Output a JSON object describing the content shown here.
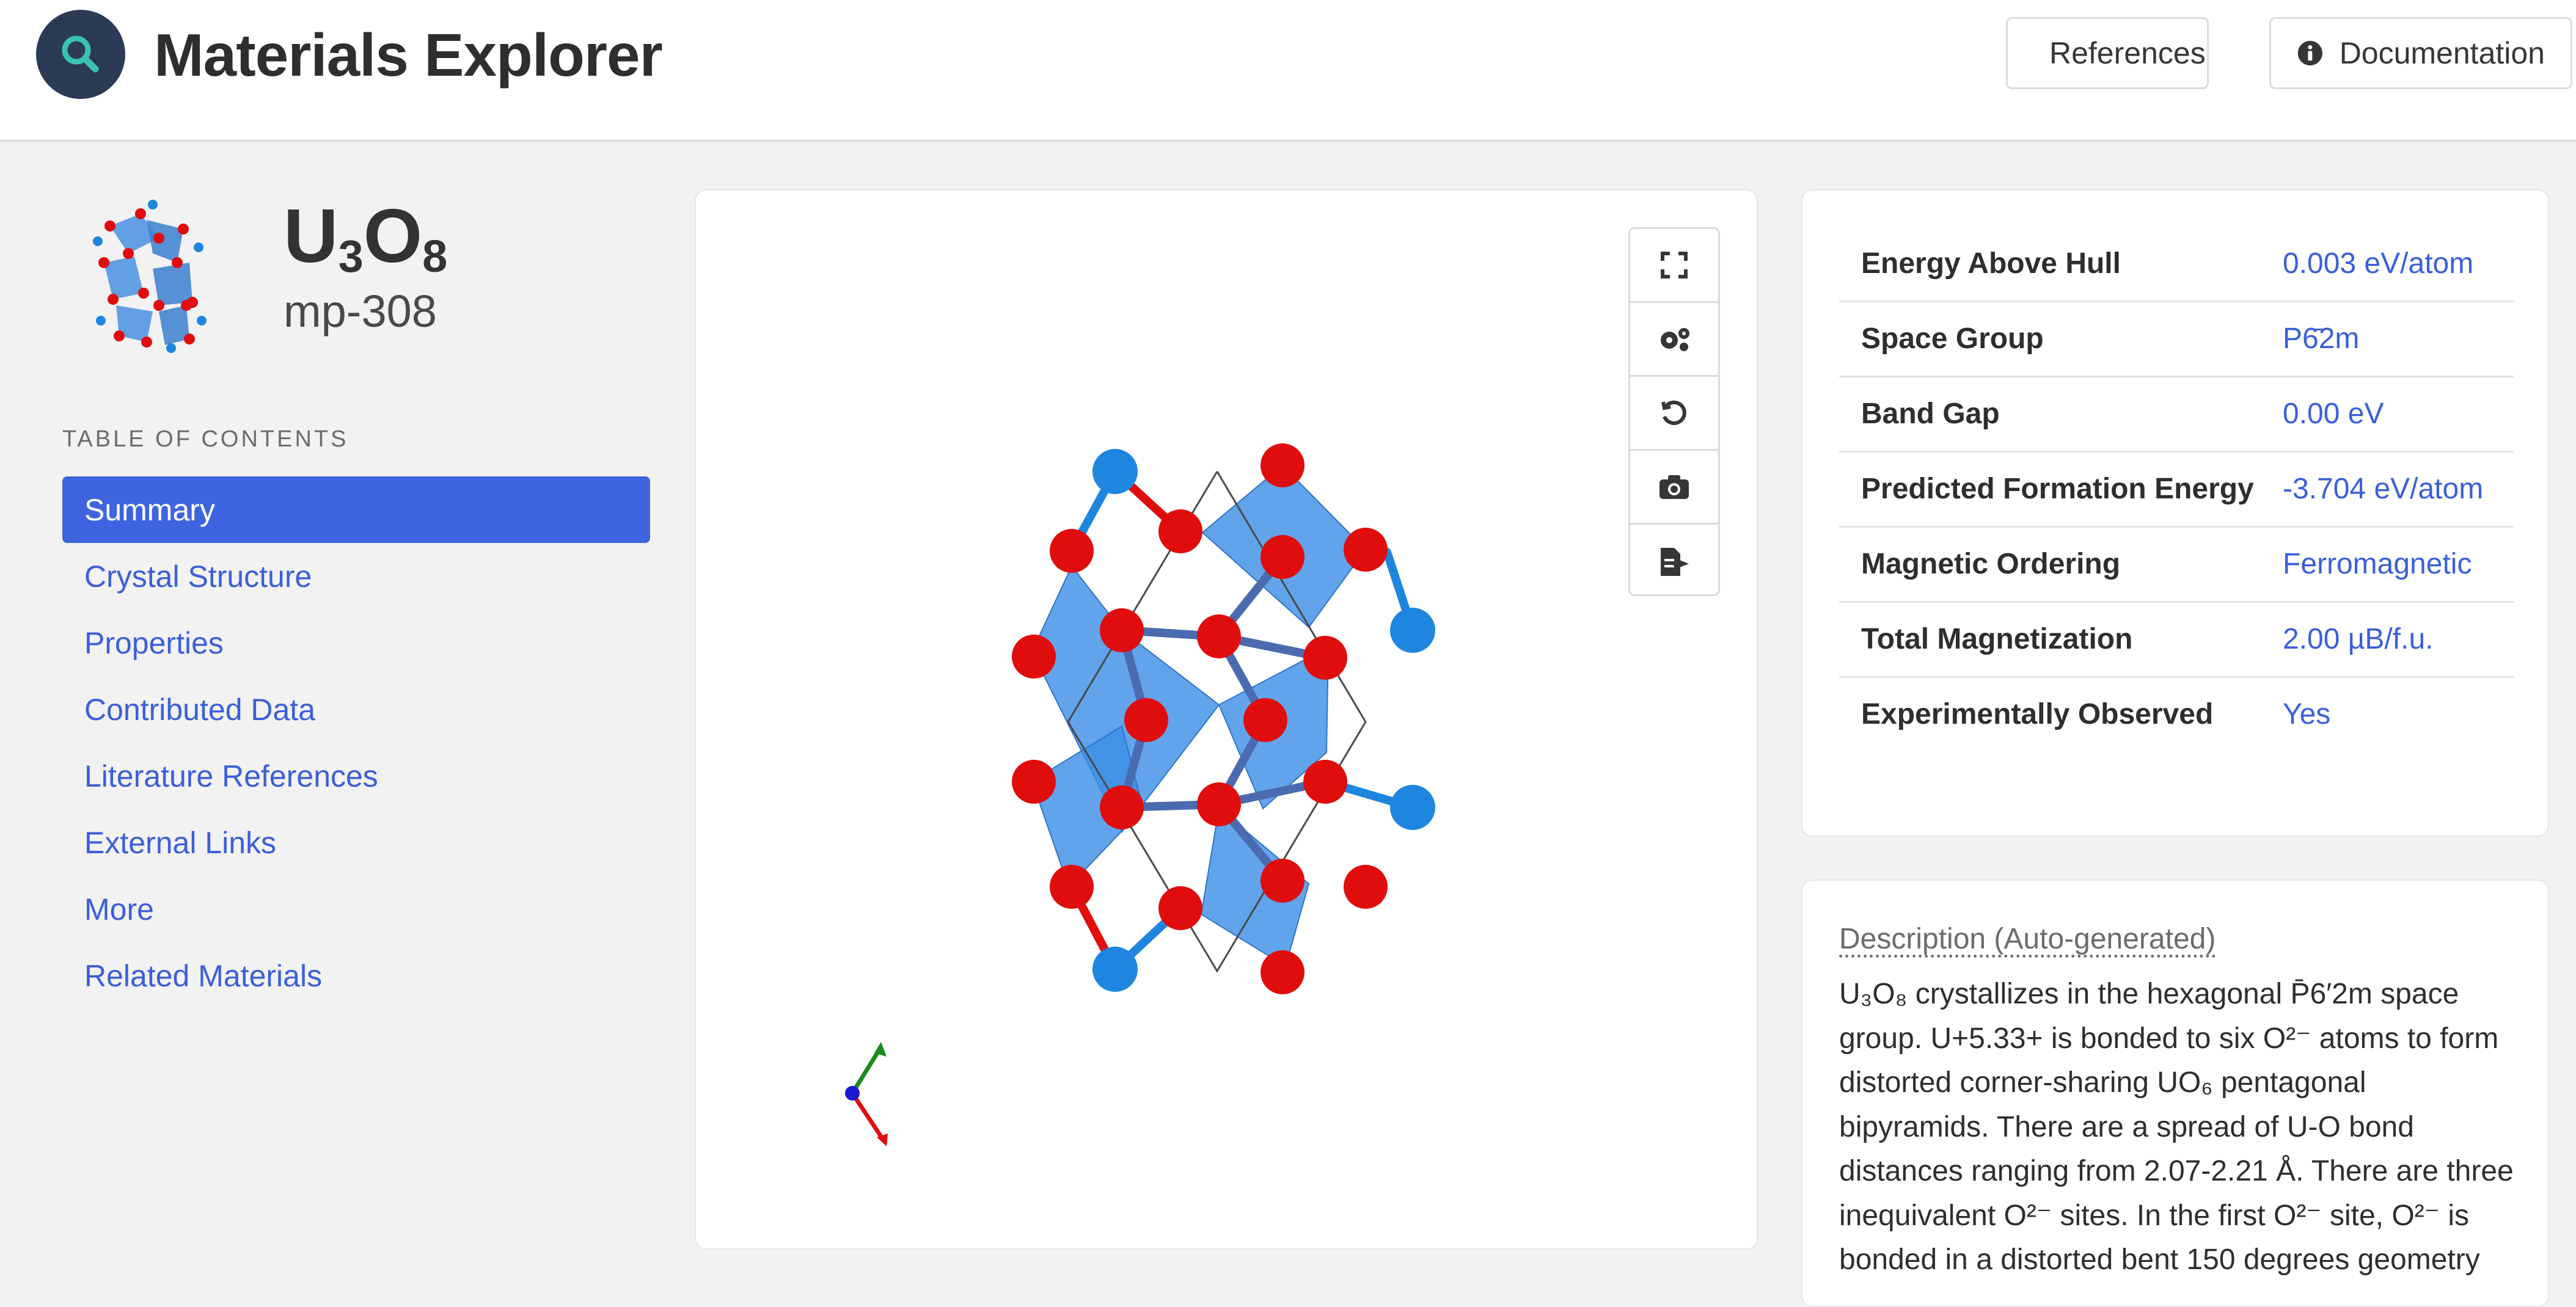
{
  "header": {
    "app_title": "Materials Explorer",
    "logo_icon": "search-icon",
    "buttons": [
      {
        "label": "References",
        "icon": "book-icon"
      },
      {
        "label": "Documentation",
        "icon": "info-icon"
      }
    ]
  },
  "material": {
    "formula_element": "U",
    "formula_u_count": "3",
    "formula_o": "O",
    "formula_o_count": "8",
    "id": "mp-308"
  },
  "toc": {
    "heading": "TABLE OF CONTENTS",
    "items": [
      {
        "label": "Summary",
        "active": true
      },
      {
        "label": "Crystal Structure",
        "active": false
      },
      {
        "label": "Properties",
        "active": false
      },
      {
        "label": "Contributed Data",
        "active": false
      },
      {
        "label": "Literature References",
        "active": false
      },
      {
        "label": "External Links",
        "active": false
      },
      {
        "label": "More",
        "active": false
      },
      {
        "label": "Related Materials",
        "active": false
      }
    ]
  },
  "viewer": {
    "tools": [
      {
        "icon": "expand-icon"
      },
      {
        "icon": "settings-icon"
      },
      {
        "icon": "reset-icon"
      },
      {
        "icon": "camera-icon"
      },
      {
        "icon": "export-icon"
      }
    ],
    "colors": {
      "uranium": "#1f86e0",
      "oxygen": "#e00d0d",
      "polyhedra": "#3b8de6"
    }
  },
  "properties": [
    {
      "key": "Energy Above Hull",
      "value": "0.003 eV/atom"
    },
    {
      "key": "Space Group",
      "value": "P6̄2m"
    },
    {
      "key": "Band Gap",
      "value": "0.00 eV"
    },
    {
      "key": "Predicted Formation Energy",
      "value": "-3.704 eV/atom"
    },
    {
      "key": "Magnetic Ordering",
      "value": "Ferromagnetic"
    },
    {
      "key": "Total Magnetization",
      "value": "2.00 µB/f.u."
    },
    {
      "key": "Experimentally Observed",
      "value": "Yes"
    }
  ],
  "description": {
    "title": "Description (Auto-generated)",
    "text": "U₃O₈ crystallizes in the hexagonal P̄6′2m space group. U+5.33+ is bonded to six O²⁻ atoms to form distorted corner-sharing UO₆ pentagonal bipyramids. There are a spread of U-O bond distances ranging from 2.07-2.21 Å. There are three inequivalent O²⁻ sites. In the first O²⁻ site, O²⁻ is bonded in a distorted bent 150 degrees geometry"
  }
}
